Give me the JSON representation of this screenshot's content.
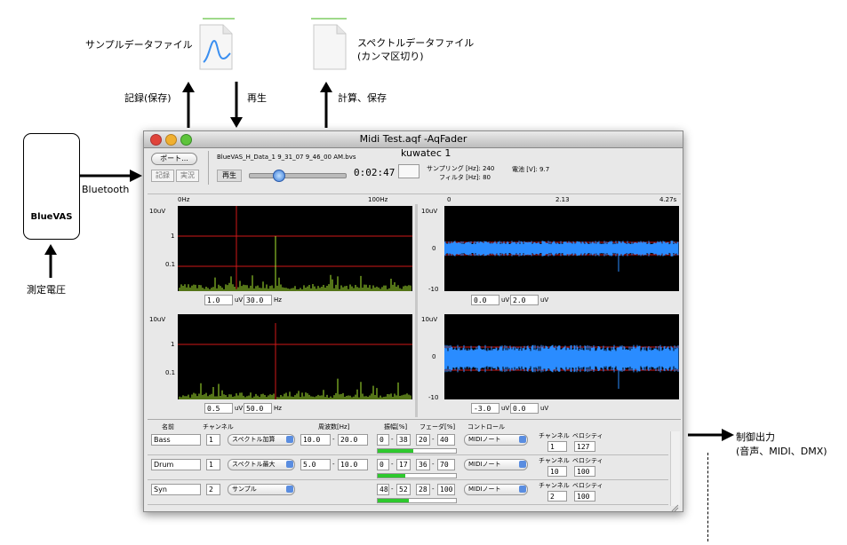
{
  "diagram": {
    "sample_file_label": "サンプルデータファイル",
    "spectrum_file_label": "スペクトルデータファイル",
    "spectrum_file_sub": "(カンマ区切り)",
    "record_save_label": "記録(保存)",
    "play_label": "再生",
    "calc_save_label": "計算、保存",
    "bluetooth_label": "Bluetooth",
    "device_label": "BlueVAS",
    "measure_label": "測定電圧",
    "output_label": "制御出力",
    "output_sub": "(音声、MIDI、DMX)"
  },
  "window": {
    "title": "Midi Test.aqf -AqFader",
    "port_button": "ポート...",
    "record_button": "記録",
    "live_button": "実況",
    "play_button": "再生",
    "filename": "BlueVAS_H_Data_1 9_31_07 9_46_00 AM.bvs",
    "device_name": "kuwatec 1",
    "time": "0:02:47",
    "progress": 0.3,
    "sampling": "サンプリング [Hz]: 240",
    "filter": "フィルタ [Hz]: 80",
    "battery": "電池 [V]: 9.7"
  },
  "spectrum_axis": {
    "left": "0Hz",
    "right": "100Hz"
  },
  "time_axis": {
    "left": "0",
    "mid": "2.13",
    "right": "4.27s"
  },
  "spectrum_plots": [
    {
      "y_top": "10uV",
      "y_mid": "1",
      "y_low": "0.1",
      "min": "1.0",
      "unit1": "uV",
      "max": "30.0",
      "unit2": "Hz"
    },
    {
      "y_top": "10uV",
      "y_mid": "1",
      "y_low": "0.1",
      "min": "0.5",
      "unit1": "uV",
      "max": "50.0",
      "unit2": "Hz"
    }
  ],
  "time_plots": [
    {
      "y_top": "10uV",
      "y_mid": "0",
      "y_low": "-10",
      "min": "0.0",
      "unit1": "uV",
      "max": "2.0",
      "unit2": "uV"
    },
    {
      "y_top": "10uV",
      "y_mid": "0",
      "y_low": "-10",
      "min": "-3.0",
      "unit1": "uV",
      "max": "0.0",
      "unit2": "uV"
    }
  ],
  "table": {
    "headers": {
      "name": "名前",
      "channel": "チャンネル",
      "freq": "周波数[Hz]",
      "amp": "振幅[%]",
      "fade": "フェーダ[%]",
      "control": "コントロール"
    },
    "sub_channel": "チャンネル",
    "sub_velocity": "ベロシティ",
    "rows": [
      {
        "name": "Bass",
        "ch": "1",
        "mode": "スペクトル加算",
        "f1": "10.0",
        "f2": "20.0",
        "a1": "0",
        "a2": "38",
        "d1": "20",
        "d2": "40",
        "ctrl": "MIDIノート",
        "mch": "1",
        "vel": "127",
        "level": 0.45
      },
      {
        "name": "Drum",
        "ch": "1",
        "mode": "スペクトル最大",
        "f1": "5.0",
        "f2": "10.0",
        "a1": "0",
        "a2": "17",
        "d1": "36",
        "d2": "70",
        "ctrl": "MIDIノート",
        "mch": "10",
        "vel": "100",
        "level": 0.35
      },
      {
        "name": "Syn",
        "ch": "2",
        "mode": "サンプル",
        "f1": "",
        "f2": "",
        "a1": "48",
        "a2": "52",
        "d1": "28",
        "d2": "100",
        "ctrl": "MIDIノート",
        "mch": "2",
        "vel": "100",
        "level": 0.4
      }
    ]
  },
  "colors": {
    "spectrum": "#a8e830",
    "signal": "#2a8cff",
    "cursor": "#d01818"
  }
}
